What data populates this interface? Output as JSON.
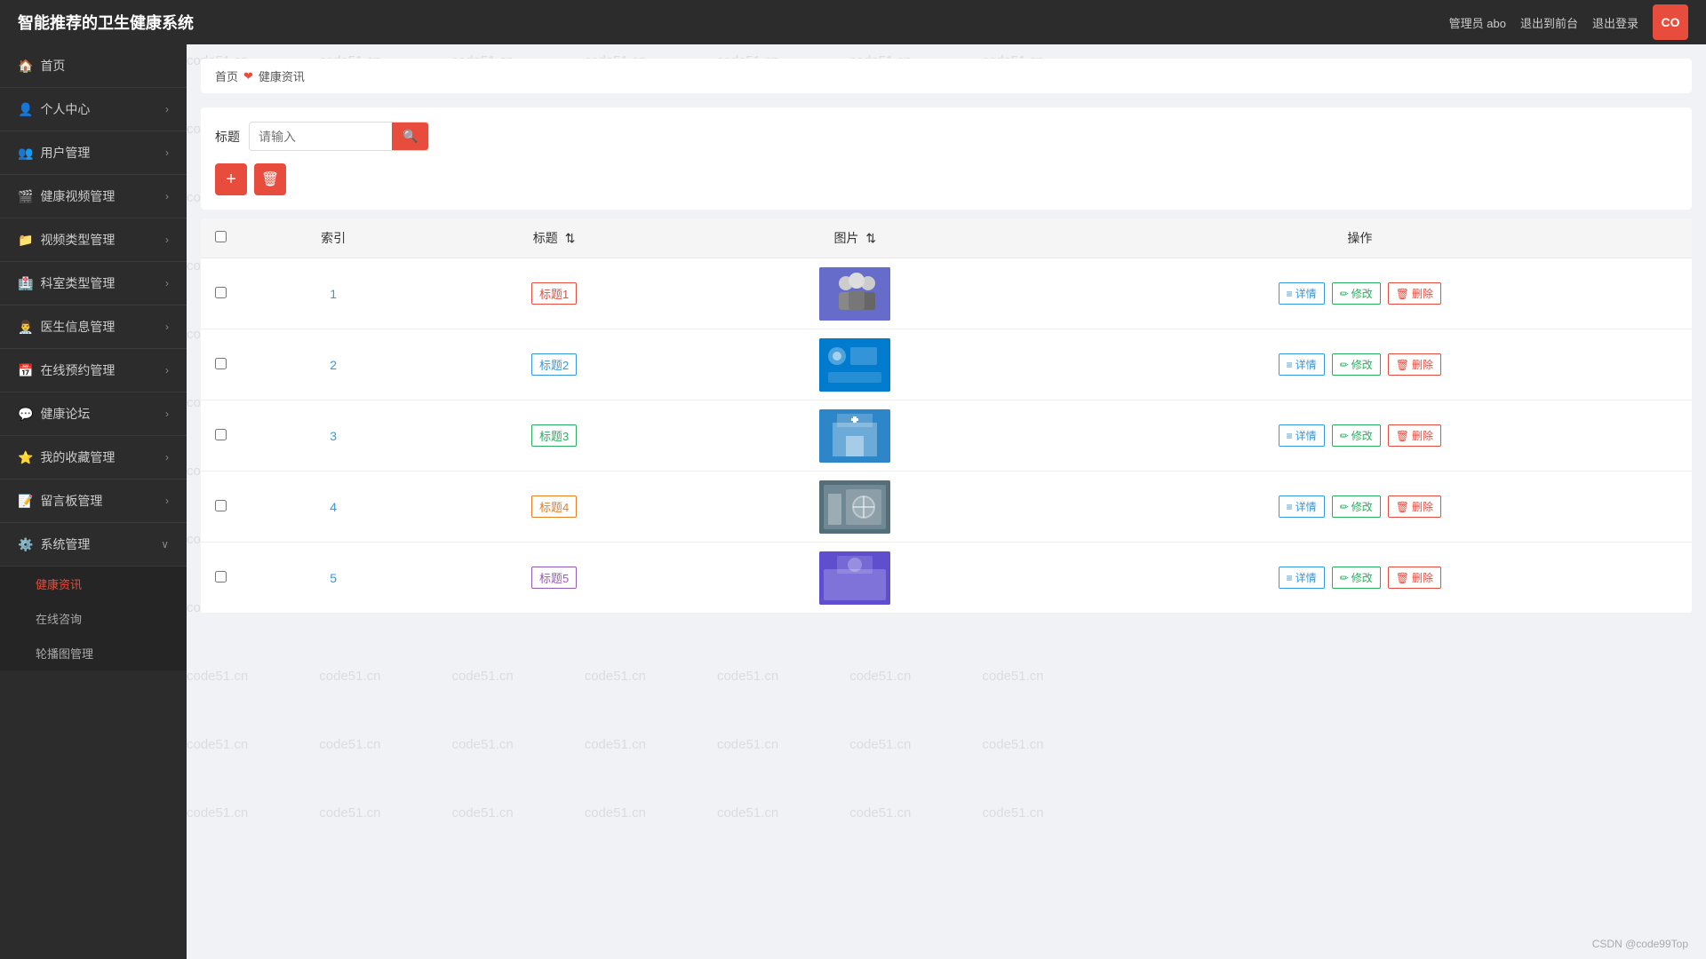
{
  "header": {
    "title": "智能推荐的卫生健康系统",
    "admin_label": "管理员 abo",
    "back_label": "退出到前台",
    "logout_label": "退出登录",
    "avatar": "CO"
  },
  "sidebar": {
    "items": [
      {
        "id": "home",
        "label": "首页",
        "icon": "🏠",
        "has_children": false
      },
      {
        "id": "personal",
        "label": "个人中心",
        "icon": "👤",
        "has_children": true
      },
      {
        "id": "user-mgmt",
        "label": "用户管理",
        "icon": "👥",
        "has_children": true
      },
      {
        "id": "health-video",
        "label": "健康视频管理",
        "icon": "🎬",
        "has_children": true
      },
      {
        "id": "video-type",
        "label": "视频类型管理",
        "icon": "📁",
        "has_children": true
      },
      {
        "id": "dept-type",
        "label": "科室类型管理",
        "icon": "🏥",
        "has_children": true
      },
      {
        "id": "doctor-info",
        "label": "医生信息管理",
        "icon": "👨‍⚕️",
        "has_children": true
      },
      {
        "id": "online-appt",
        "label": "在线预约管理",
        "icon": "📅",
        "has_children": true
      },
      {
        "id": "health-forum",
        "label": "健康论坛",
        "icon": "💬",
        "has_children": true
      },
      {
        "id": "my-favorites",
        "label": "我的收藏管理",
        "icon": "⭐",
        "has_children": true
      },
      {
        "id": "guestbook",
        "label": "留言板管理",
        "icon": "📝",
        "has_children": true
      },
      {
        "id": "system-mgmt",
        "label": "系统管理",
        "icon": "⚙️",
        "has_children": true,
        "expanded": true
      }
    ],
    "sub_items": [
      {
        "id": "health-news",
        "label": "健康资讯",
        "active": true
      },
      {
        "id": "online-consult",
        "label": "在线咨询"
      },
      {
        "id": "carousel-mgmt",
        "label": "轮播图管理"
      }
    ]
  },
  "breadcrumb": {
    "home": "首页",
    "separator": "❤",
    "current": "健康资讯"
  },
  "search": {
    "label": "标题",
    "placeholder": "请输入",
    "button_icon": "🔍"
  },
  "toolbar": {
    "add_label": "+",
    "delete_label": "🗑"
  },
  "table": {
    "columns": [
      "索引",
      "标题",
      "图片",
      "操作"
    ],
    "rows": [
      {
        "index": "1",
        "title": "",
        "tag": "标题1",
        "tag_class": "tag-red",
        "image_id": "img1",
        "actions": [
          "详情",
          "修改",
          "删除"
        ]
      },
      {
        "index": "2",
        "title": "",
        "tag": "标题2",
        "tag_class": "tag-blue",
        "image_id": "img2",
        "actions": [
          "详情",
          "修改",
          "删除"
        ]
      },
      {
        "index": "3",
        "title": "",
        "tag": "标题3",
        "tag_class": "tag-green",
        "image_id": "img3",
        "actions": [
          "详情",
          "修改",
          "删除"
        ]
      },
      {
        "index": "4",
        "title": "",
        "tag": "标题4",
        "tag_class": "tag-orange",
        "image_id": "img4",
        "actions": [
          "详情",
          "修改",
          "删除"
        ]
      },
      {
        "index": "5",
        "title": "",
        "tag": "标题5",
        "tag_class": "tag-purple",
        "image_id": "img5",
        "actions": [
          "详情",
          "修改",
          "删除"
        ]
      }
    ],
    "action_labels": {
      "detail": "详情",
      "edit": "修改",
      "delete": "删除"
    }
  },
  "watermark": "code51.cn",
  "footer": "CSDN @code99Top"
}
